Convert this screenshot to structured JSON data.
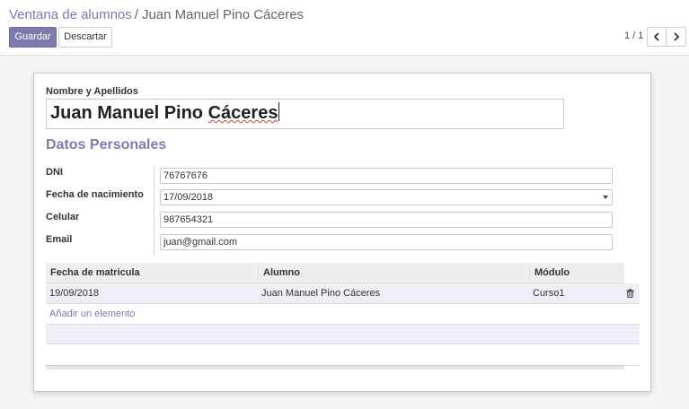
{
  "breadcrumb": {
    "parent": "Ventana de alumnos",
    "separator": "/",
    "current": "Juan Manuel Pino Cáceres"
  },
  "toolbar": {
    "save_label": "Guardar",
    "discard_label": "Descartar"
  },
  "pager": {
    "value": "1 / 1",
    "prev_icon": "chevron-left-icon",
    "next_icon": "chevron-right-icon"
  },
  "form": {
    "name_label": "Nombre y Apellidos",
    "name_first": "Juan Manuel Pino",
    "name_last": "Cáceres",
    "section_title": "Datos Personales",
    "fields": {
      "dni": {
        "label": "DNI",
        "value": "76767676"
      },
      "birthdate": {
        "label": "Fecha de nacimiento",
        "value": "17/09/2018"
      },
      "phone": {
        "label": "Celular",
        "value": "987654321"
      },
      "email": {
        "label": "Email",
        "value": "juan@gmail.com"
      }
    }
  },
  "table": {
    "headers": [
      "Fecha de matricula",
      "Alumno",
      "Módulo"
    ],
    "rows": [
      [
        "19/09/2018",
        "Juan Manuel Pino Cáceres",
        "Curso1"
      ]
    ],
    "row_delete_icon": "trash-icon",
    "add_line": "Añadir un elemento"
  },
  "colors": {
    "accent": "#7c7bad",
    "row_highlight": "#eeeef6"
  }
}
